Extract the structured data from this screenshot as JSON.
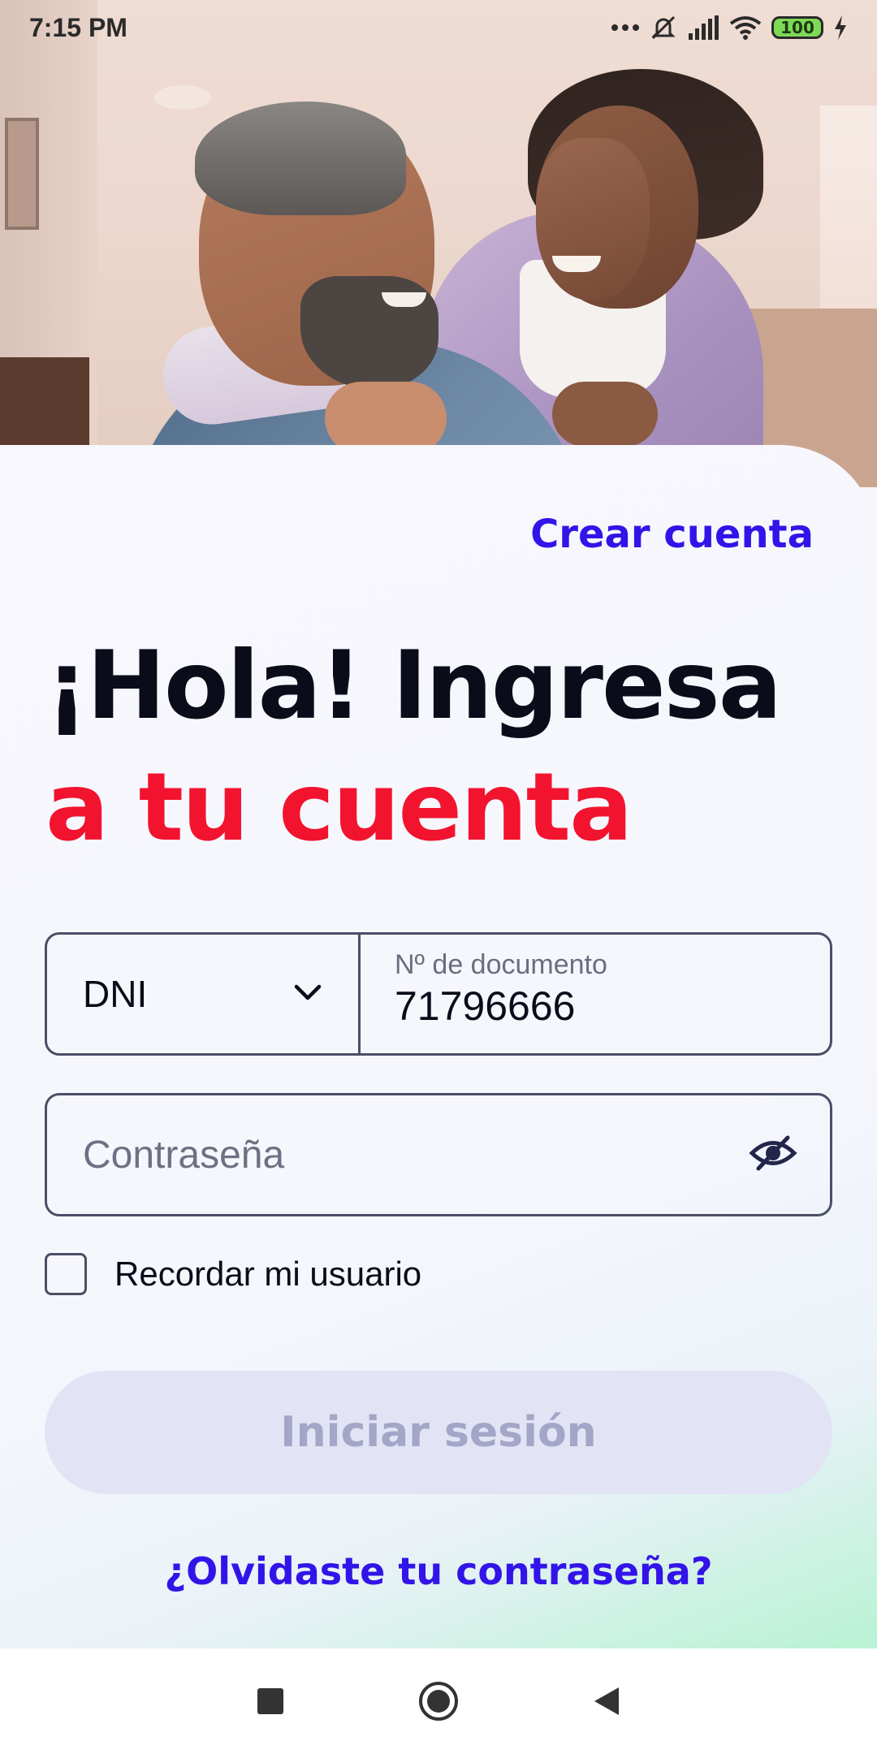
{
  "status_bar": {
    "time": "7:15 PM",
    "battery": "100",
    "icons": [
      "more-dots-icon",
      "bell-muted-icon",
      "signal-icon",
      "wifi-icon",
      "battery-icon",
      "charging-icon"
    ]
  },
  "hero": {
    "image_description_icon": "couple-photo"
  },
  "header": {
    "create_account_label": "Crear cuenta"
  },
  "heading": {
    "line1": "¡Hola! Ingresa",
    "line2": "a tu cuenta",
    "line1_color": "#0a0c1a",
    "line2_color": "#f2132f"
  },
  "form": {
    "document_type": {
      "selected": "DNI",
      "icon": "chevron-down-icon"
    },
    "document_number": {
      "label": "Nº de documento",
      "value": "71796666"
    },
    "password": {
      "placeholder": "Contraseña",
      "value": "",
      "icon": "eye-off-icon"
    },
    "remember": {
      "label": "Recordar mi usuario",
      "checked": false
    },
    "submit_label": "Iniciar sesión",
    "forgot_label": "¿Olvidaste tu contraseña?"
  },
  "colors": {
    "accent": "#3314e8",
    "brand_red": "#f2132f",
    "button_disabled_bg": "#e3e3f6",
    "button_disabled_text": "#a3a6c6"
  },
  "nav_bar": {
    "icons": [
      "recents-square-icon",
      "home-circle-icon",
      "back-triangle-icon"
    ]
  }
}
